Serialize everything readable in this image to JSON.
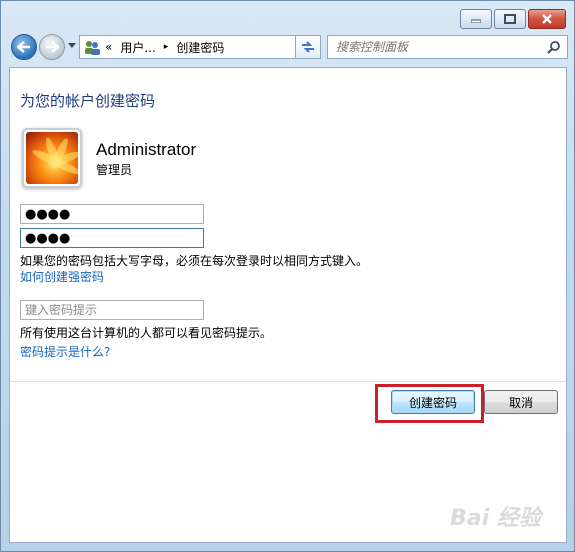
{
  "colors": {
    "accent": "#1e3b82",
    "link": "#1565c0",
    "highlight_box": "#c9202a"
  },
  "titlebar": {
    "minimize_icon": "minimize-icon",
    "maximize_icon": "maximize-icon",
    "close_icon": "close-icon"
  },
  "navbar": {
    "back_icon": "back-arrow-icon",
    "forward_icon": "forward-arrow-icon",
    "address": {
      "icon": "users-icon",
      "overflow": "«",
      "crumbs": [
        "用户...",
        "创建密码"
      ],
      "separator": "▸"
    },
    "refresh_icon": "refresh-icon",
    "search_placeholder": "搜索控制面板",
    "search_icon": "search-icon"
  },
  "page": {
    "title": "为您的帐户创建密码",
    "user": {
      "name": "Administrator",
      "role": "管理员",
      "avatar_icon": "flower-avatar"
    },
    "new_password": "●●●●",
    "confirm_password": "●●●●",
    "case_note": "如果您的密码包括大写字母，必须在每次登录时以相同方式键入。",
    "strong_password_link": "如何创建强密码",
    "hint_placeholder": "键入密码提示",
    "hint_note": "所有使用这台计算机的人都可以看见密码提示。",
    "hint_link": "密码提示是什么?",
    "buttons": {
      "create": "创建密码",
      "cancel": "取消"
    }
  },
  "watermark": "Bai 经验"
}
